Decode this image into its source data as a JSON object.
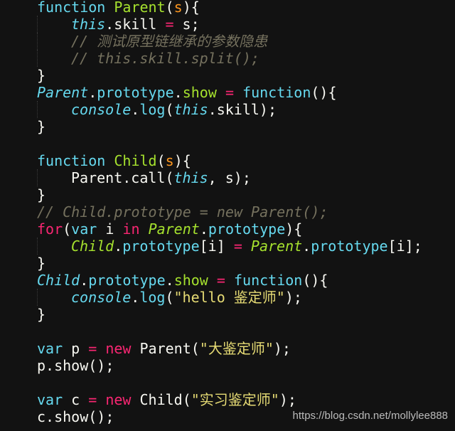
{
  "colors": {
    "background": "#121212",
    "keyword": "#66d9ef",
    "function_name": "#a6e22e",
    "parameter": "#fd971f",
    "operator": "#f92672",
    "comment": "#75715e",
    "string": "#e6db74",
    "text": "#f8f8f2"
  },
  "code_lines": [
    {
      "indent": 0,
      "tokens": [
        [
          "function ",
          "kw"
        ],
        [
          "Parent",
          "fn"
        ],
        [
          "(",
          "txt"
        ],
        [
          "s",
          "prm"
        ],
        [
          "){",
          "txt"
        ]
      ]
    },
    {
      "indent": 1,
      "tokens": [
        [
          "this",
          "kwi"
        ],
        [
          ".skill ",
          "txt"
        ],
        [
          "=",
          "op"
        ],
        [
          " s;",
          "txt"
        ]
      ]
    },
    {
      "indent": 1,
      "tokens": [
        [
          "// 测试原型链继承的参数隐患",
          "cm"
        ]
      ]
    },
    {
      "indent": 1,
      "tokens": [
        [
          "// this.skill.split();",
          "cm"
        ]
      ]
    },
    {
      "indent": 0,
      "tokens": [
        [
          "}",
          "txt"
        ]
      ]
    },
    {
      "indent": 0,
      "tokens": [
        [
          "Parent",
          "clsb"
        ],
        [
          ".",
          "txt"
        ],
        [
          "prototype",
          "prop"
        ],
        [
          ".",
          "txt"
        ],
        [
          "show",
          "fn"
        ],
        [
          " ",
          "txt"
        ],
        [
          "=",
          "op"
        ],
        [
          " ",
          "txt"
        ],
        [
          "function",
          "kw"
        ],
        [
          "(){",
          "txt"
        ]
      ]
    },
    {
      "indent": 1,
      "tokens": [
        [
          "console",
          "kwi"
        ],
        [
          ".",
          "txt"
        ],
        [
          "log",
          "prop"
        ],
        [
          "(",
          "txt"
        ],
        [
          "this",
          "kwi"
        ],
        [
          ".skill);",
          "txt"
        ]
      ]
    },
    {
      "indent": 0,
      "tokens": [
        [
          "}",
          "txt"
        ]
      ]
    },
    {
      "indent": 0,
      "tokens": []
    },
    {
      "indent": 0,
      "tokens": [
        [
          "function ",
          "kw"
        ],
        [
          "Child",
          "fn"
        ],
        [
          "(",
          "txt"
        ],
        [
          "s",
          "prm"
        ],
        [
          "){",
          "txt"
        ]
      ]
    },
    {
      "indent": 1,
      "tokens": [
        [
          "Parent.call(",
          "txt"
        ],
        [
          "this",
          "kwi"
        ],
        [
          ", s);",
          "txt"
        ]
      ]
    },
    {
      "indent": 0,
      "tokens": [
        [
          "}",
          "txt"
        ]
      ]
    },
    {
      "indent": 0,
      "tokens": [
        [
          "// Child.prototype = new Parent();",
          "cm"
        ]
      ]
    },
    {
      "indent": 0,
      "tokens": [
        [
          "for",
          "op"
        ],
        [
          "(",
          "txt"
        ],
        [
          "var",
          "kw"
        ],
        [
          " i ",
          "txt"
        ],
        [
          "in",
          "op"
        ],
        [
          " ",
          "txt"
        ],
        [
          "Parent",
          "cls"
        ],
        [
          ".",
          "txt"
        ],
        [
          "prototype",
          "prop"
        ],
        [
          "){",
          "txt"
        ]
      ]
    },
    {
      "indent": 1,
      "tokens": [
        [
          "Child",
          "cls"
        ],
        [
          ".",
          "txt"
        ],
        [
          "prototype",
          "prop"
        ],
        [
          "[i] ",
          "txt"
        ],
        [
          "=",
          "op"
        ],
        [
          " ",
          "txt"
        ],
        [
          "Parent",
          "cls"
        ],
        [
          ".",
          "txt"
        ],
        [
          "prototype",
          "prop"
        ],
        [
          "[i];",
          "txt"
        ]
      ]
    },
    {
      "indent": 0,
      "tokens": [
        [
          "}",
          "txt"
        ]
      ]
    },
    {
      "indent": 0,
      "tokens": [
        [
          "Child",
          "clsb"
        ],
        [
          ".",
          "txt"
        ],
        [
          "prototype",
          "prop"
        ],
        [
          ".",
          "txt"
        ],
        [
          "show",
          "fn"
        ],
        [
          " ",
          "txt"
        ],
        [
          "=",
          "op"
        ],
        [
          " ",
          "txt"
        ],
        [
          "function",
          "kw"
        ],
        [
          "(){",
          "txt"
        ]
      ]
    },
    {
      "indent": 1,
      "tokens": [
        [
          "console",
          "kwi"
        ],
        [
          ".",
          "txt"
        ],
        [
          "log",
          "prop"
        ],
        [
          "(",
          "txt"
        ],
        [
          "\"hello 鉴定师\"",
          "str"
        ],
        [
          ");",
          "txt"
        ]
      ]
    },
    {
      "indent": 0,
      "tokens": [
        [
          "}",
          "txt"
        ]
      ]
    },
    {
      "indent": 0,
      "tokens": []
    },
    {
      "indent": 0,
      "tokens": [
        [
          "var",
          "kw"
        ],
        [
          " p ",
          "txt"
        ],
        [
          "=",
          "op"
        ],
        [
          " ",
          "txt"
        ],
        [
          "new",
          "op"
        ],
        [
          " Parent(",
          "txt"
        ],
        [
          "\"大鉴定师\"",
          "str"
        ],
        [
          ");",
          "txt"
        ]
      ]
    },
    {
      "indent": 0,
      "tokens": [
        [
          "p.show();",
          "txt"
        ]
      ]
    },
    {
      "indent": 0,
      "tokens": []
    },
    {
      "indent": 0,
      "tokens": [
        [
          "var",
          "kw"
        ],
        [
          " c ",
          "txt"
        ],
        [
          "=",
          "op"
        ],
        [
          " ",
          "txt"
        ],
        [
          "new",
          "op"
        ],
        [
          " Child(",
          "txt"
        ],
        [
          "\"实习鉴定师\"",
          "str"
        ],
        [
          ");",
          "txt"
        ]
      ]
    },
    {
      "indent": 0,
      "tokens": [
        [
          "c.show();",
          "txt"
        ]
      ]
    }
  ],
  "watermark": "https://blog.csdn.net/mollylee888"
}
